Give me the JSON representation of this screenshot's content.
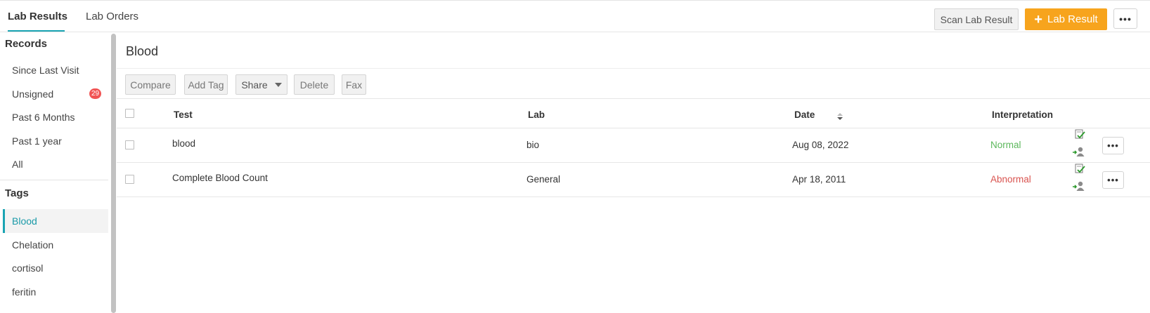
{
  "tabs": [
    {
      "label": "Lab Results",
      "active": true
    },
    {
      "label": "Lab Orders",
      "active": false
    }
  ],
  "header_actions": {
    "scan_label": "Scan Lab Result",
    "add_label": "Lab Result",
    "more_label": "•••"
  },
  "sidebar": {
    "records_heading": "Records",
    "records": [
      {
        "label": "Since Last Visit"
      },
      {
        "label": "Unsigned",
        "badge": "29"
      },
      {
        "label": "Past 6 Months"
      },
      {
        "label": "Past 1 year"
      },
      {
        "label": "All"
      }
    ],
    "tags_heading": "Tags",
    "tags": [
      {
        "label": "Blood",
        "selected": true
      },
      {
        "label": "Chelation"
      },
      {
        "label": "cortisol"
      },
      {
        "label": "feritin"
      }
    ]
  },
  "main": {
    "title": "Blood",
    "toolbar": {
      "compare": "Compare",
      "add_tag": "Add Tag",
      "share": "Share",
      "delete": "Delete",
      "fax": "Fax"
    },
    "columns": {
      "test": "Test",
      "lab": "Lab",
      "date": "Date",
      "interpretation": "Interpretation"
    },
    "rows": [
      {
        "test": "blood",
        "lab": "bio",
        "date": "Aug 08, 2022",
        "interpretation": "Normal",
        "interpretation_color": "#5cb85c",
        "more": "•••"
      },
      {
        "test": "Complete Blood Count",
        "lab": "General",
        "date": "Apr 18, 2011",
        "interpretation": "Abnormal",
        "interpretation_color": "#d9534f",
        "more": "•••"
      }
    ]
  },
  "colors": {
    "accent": "#1aa4b3",
    "primary_button": "#f7a41d",
    "badge": "#f15454"
  },
  "icons": [
    "plus-icon",
    "caret-down-icon",
    "sort-icon",
    "signed-document-icon",
    "assign-user-icon"
  ]
}
